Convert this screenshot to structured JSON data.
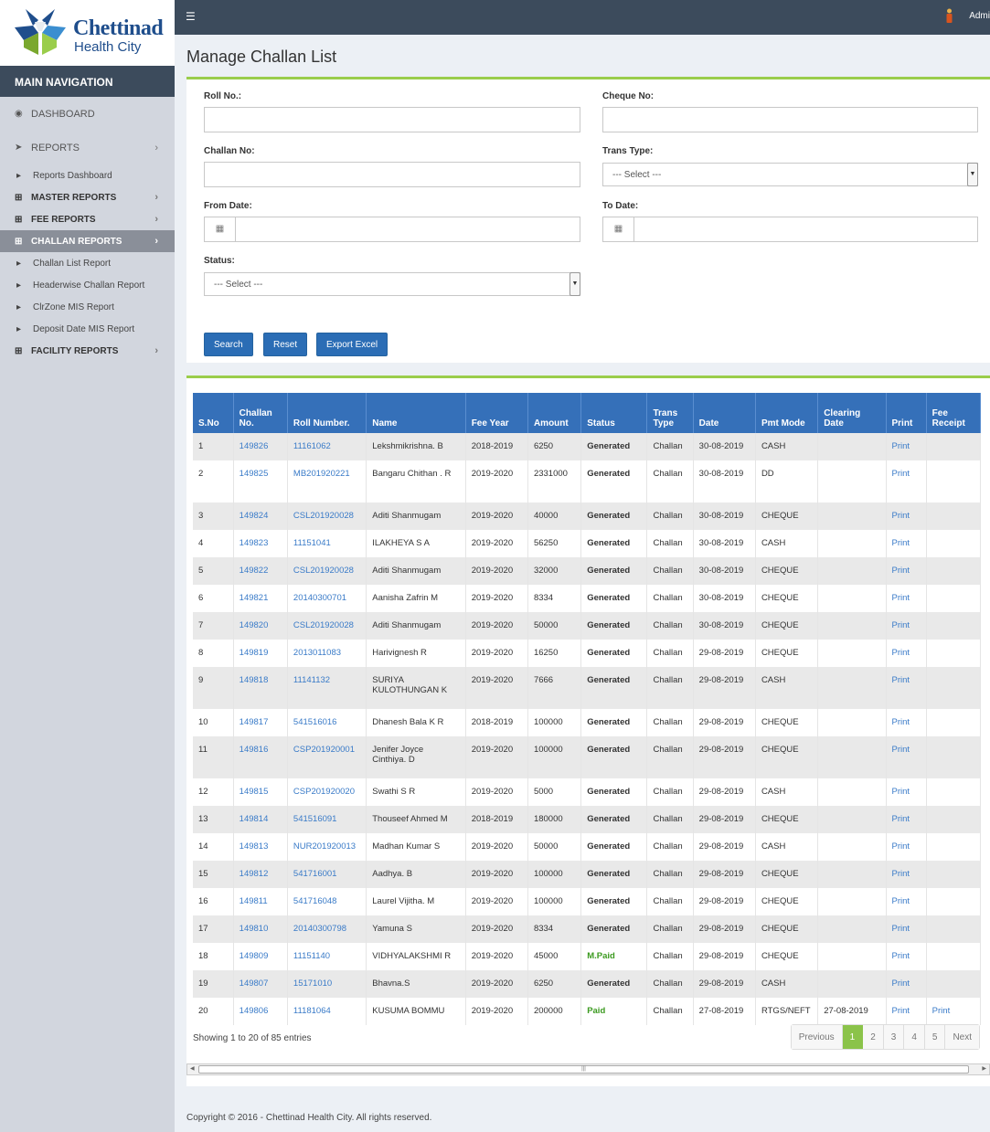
{
  "brand": {
    "name": "Chettinad",
    "sub": "Health City"
  },
  "nav": {
    "heading": "MAIN NAVIGATION",
    "items": [
      {
        "label": "DASHBOARD",
        "type": "top",
        "icon": "dashboard-icon"
      },
      {
        "label": "REPORTS",
        "type": "top",
        "icon": "send-icon",
        "arrow": "›"
      },
      {
        "label": "Reports Dashboard",
        "type": "sub"
      },
      {
        "label": "MASTER REPORTS",
        "type": "bold",
        "arrow": "›"
      },
      {
        "label": "FEE REPORTS",
        "type": "bold",
        "arrow": "›"
      },
      {
        "label": "CHALLAN REPORTS",
        "type": "bold",
        "arrow": "›",
        "active": true
      },
      {
        "label": "Challan List Report",
        "type": "sub"
      },
      {
        "label": "Headerwise Challan Report",
        "type": "sub"
      },
      {
        "label": "ClrZone MIS Report",
        "type": "sub"
      },
      {
        "label": "Deposit Date MIS Report",
        "type": "sub"
      },
      {
        "label": "FACILITY REPORTS",
        "type": "bold",
        "arrow": "›"
      }
    ]
  },
  "topbar": {
    "user": "Admi"
  },
  "page": {
    "title": "Manage Challan List"
  },
  "form": {
    "roll_label": "Roll No.:",
    "cheque_label": "Cheque No:",
    "challan_label": "Challan No:",
    "trans_label": "Trans Type:",
    "trans_value": "--- Select ---",
    "from_label": "From Date:",
    "to_label": "To Date:",
    "status_label": "Status:",
    "status_value": "--- Select ---",
    "search": "Search",
    "reset": "Reset",
    "export": "Export Excel"
  },
  "table": {
    "headers": [
      "S.No",
      "Challan No.",
      "Roll Number.",
      "Name",
      "Fee Year",
      "Amount",
      "Status",
      "Trans Type",
      "Date",
      "Pmt Mode",
      "Clearing Date",
      "Print",
      "Fee Receipt"
    ],
    "rows": [
      [
        "1",
        "149826",
        "11161062",
        "Lekshmikrishna. B",
        "2018-2019",
        "6250",
        "Generated",
        "Challan",
        "30-08-2019",
        "CASH",
        "",
        "Print",
        ""
      ],
      [
        "2",
        "149825",
        "MB201920221",
        "Bangaru Chithan . R",
        "2019-2020",
        "2331000",
        "Generated",
        "Challan",
        "30-08-2019",
        "DD",
        "",
        "Print",
        ""
      ],
      [
        "3",
        "149824",
        "CSL201920028",
        "Aditi Shanmugam",
        "2019-2020",
        "40000",
        "Generated",
        "Challan",
        "30-08-2019",
        "CHEQUE",
        "",
        "Print",
        ""
      ],
      [
        "4",
        "149823",
        "11151041",
        "ILAKHEYA S A",
        "2019-2020",
        "56250",
        "Generated",
        "Challan",
        "30-08-2019",
        "CASH",
        "",
        "Print",
        ""
      ],
      [
        "5",
        "149822",
        "CSL201920028",
        "Aditi Shanmugam",
        "2019-2020",
        "32000",
        "Generated",
        "Challan",
        "30-08-2019",
        "CHEQUE",
        "",
        "Print",
        ""
      ],
      [
        "6",
        "149821",
        "20140300701",
        "Aanisha Zafrin M",
        "2019-2020",
        "8334",
        "Generated",
        "Challan",
        "30-08-2019",
        "CHEQUE",
        "",
        "Print",
        ""
      ],
      [
        "7",
        "149820",
        "CSL201920028",
        "Aditi Shanmugam",
        "2019-2020",
        "50000",
        "Generated",
        "Challan",
        "30-08-2019",
        "CHEQUE",
        "",
        "Print",
        ""
      ],
      [
        "8",
        "149819",
        "2013011083",
        "Harivignesh R",
        "2019-2020",
        "16250",
        "Generated",
        "Challan",
        "29-08-2019",
        "CHEQUE",
        "",
        "Print",
        ""
      ],
      [
        "9",
        "149818",
        "11141132",
        "SURIYA KULOTHUNGAN K",
        "2019-2020",
        "7666",
        "Generated",
        "Challan",
        "29-08-2019",
        "CASH",
        "",
        "Print",
        ""
      ],
      [
        "10",
        "149817",
        "541516016",
        "Dhanesh Bala K R",
        "2018-2019",
        "100000",
        "Generated",
        "Challan",
        "29-08-2019",
        "CHEQUE",
        "",
        "Print",
        ""
      ],
      [
        "11",
        "149816",
        "CSP201920001",
        "Jenifer Joyce Cinthiya. D",
        "2019-2020",
        "100000",
        "Generated",
        "Challan",
        "29-08-2019",
        "CHEQUE",
        "",
        "Print",
        ""
      ],
      [
        "12",
        "149815",
        "CSP201920020",
        "Swathi S R",
        "2019-2020",
        "5000",
        "Generated",
        "Challan",
        "29-08-2019",
        "CASH",
        "",
        "Print",
        ""
      ],
      [
        "13",
        "149814",
        "541516091",
        "Thouseef Ahmed M",
        "2018-2019",
        "180000",
        "Generated",
        "Challan",
        "29-08-2019",
        "CHEQUE",
        "",
        "Print",
        ""
      ],
      [
        "14",
        "149813",
        "NUR201920013",
        "Madhan Kumar S",
        "2019-2020",
        "50000",
        "Generated",
        "Challan",
        "29-08-2019",
        "CASH",
        "",
        "Print",
        ""
      ],
      [
        "15",
        "149812",
        "541716001",
        "Aadhya. B",
        "2019-2020",
        "100000",
        "Generated",
        "Challan",
        "29-08-2019",
        "CHEQUE",
        "",
        "Print",
        ""
      ],
      [
        "16",
        "149811",
        "541716048",
        "Laurel Vijitha. M",
        "2019-2020",
        "100000",
        "Generated",
        "Challan",
        "29-08-2019",
        "CHEQUE",
        "",
        "Print",
        ""
      ],
      [
        "17",
        "149810",
        "20140300798",
        "Yamuna S",
        "2019-2020",
        "8334",
        "Generated",
        "Challan",
        "29-08-2019",
        "CHEQUE",
        "",
        "Print",
        ""
      ],
      [
        "18",
        "149809",
        "11151140",
        "VIDHYALAKSHMI R",
        "2019-2020",
        "45000",
        "M.Paid",
        "Challan",
        "29-08-2019",
        "CHEQUE",
        "",
        "Print",
        ""
      ],
      [
        "19",
        "149807",
        "15171010",
        "Bhavna.S",
        "2019-2020",
        "6250",
        "Generated",
        "Challan",
        "29-08-2019",
        "CASH",
        "",
        "Print",
        ""
      ],
      [
        "20",
        "149806",
        "11181064",
        "KUSUMA BOMMU",
        "2019-2020",
        "200000",
        "Paid",
        "Challan",
        "27-08-2019",
        "RTGS/NEFT",
        "27-08-2019",
        "Print",
        "Print"
      ]
    ],
    "showing": "Showing 1 to 20 of 85 entries",
    "pager": [
      "Previous",
      "1",
      "2",
      "3",
      "4",
      "5",
      "Next"
    ],
    "active_page": "1"
  },
  "footer": "Copyright © 2016 - Chettinad Health City. All rights reserved."
}
